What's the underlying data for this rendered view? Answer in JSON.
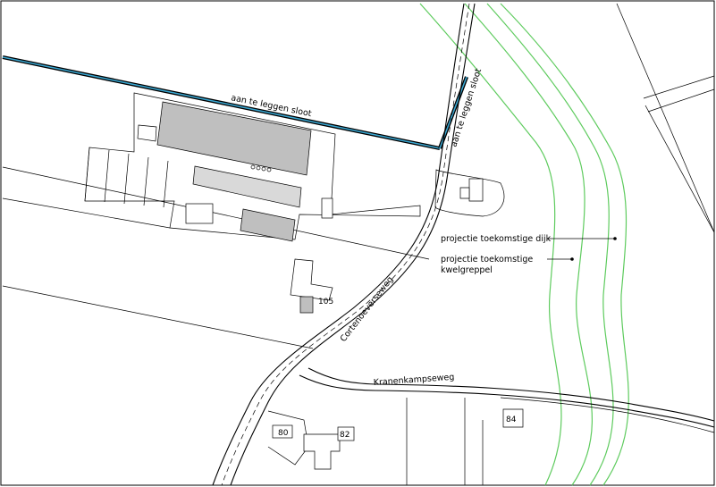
{
  "labels": {
    "sloot": "aan te leggen sloot",
    "sloot_vertical": "aan te leggen sloot",
    "cortenoeverseweg": "Cortenoeverseweg",
    "kranenkampseweg": "Kranenkampseweg",
    "dijk": "projectie toekomstige dijk",
    "kwelgreppel_line1": "projectie toekomstige",
    "kwelgreppel_line2": "kwelgreppel"
  },
  "house_numbers": {
    "n105": "105",
    "n80": "80",
    "n82": "82",
    "n84": "84"
  },
  "colors": {
    "ditch": "#3aa6d0",
    "contour": "#5ecb5e",
    "building_grey": "#bfbfbf"
  }
}
